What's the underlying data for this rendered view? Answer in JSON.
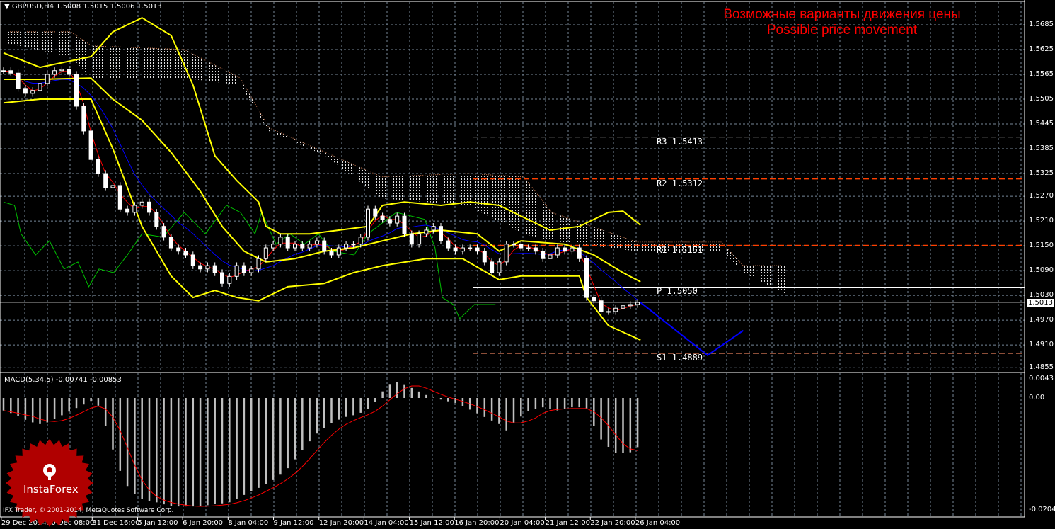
{
  "header": {
    "symbol_tf": "GBPUSD,H4",
    "ohlc": "1.5008 1.5015 1.5006 1.5013"
  },
  "annotation": {
    "ru": "Возможные варианты движения цены",
    "en": "Possible price movement"
  },
  "macd_header": "MACD(5,34,5) -0.00741 -0.00853",
  "copyright": "IFX Trader, © 2001-2014, MetaQuotes Software Corp.",
  "logo_text": "InstaForex",
  "current_price": "1.5013",
  "colors": {
    "bollinger": "#ffff00",
    "tenkan": "#ff0000",
    "kijun": "#0000ff",
    "chikou": "#00c000",
    "forecast": "#0000ff",
    "pivot_orange": "#ff4000",
    "macd_hist": "#c0c0c0",
    "macd_signal": "#ff0000",
    "grid": "#778899"
  },
  "chart_data": [
    {
      "type": "candlestick",
      "title": "GBPUSD,H4",
      "price_axis": {
        "ylim": [
          1.483,
          1.5745
        ],
        "ticks": [
          "1.5685",
          "1.5625",
          "1.5565",
          "1.5505",
          "1.5445",
          "1.5385",
          "1.5325",
          "1.5270",
          "1.5210",
          "1.5150",
          "1.5090",
          "1.5030",
          "1.4970",
          "1.4910",
          "1.4855"
        ]
      },
      "time_axis": {
        "ticks": [
          "29 Dec 2014",
          "30 Dec 08:00",
          "31 Dec 16:00",
          "5 Jan 12:00",
          "6 Jan 20:00",
          "8 Jan 04:00",
          "9 Jan 12:00",
          "12 Jan 20:00",
          "14 Jan 04:00",
          "15 Jan 12:00",
          "16 Jan 20:00",
          "20 Jan 04:00",
          "21 Jan 12:00",
          "22 Jan 20:00",
          "26 Jan 04:00"
        ]
      },
      "closes": [
        1.5574,
        1.5568,
        1.5531,
        1.5519,
        1.5526,
        1.5543,
        1.5565,
        1.5574,
        1.5577,
        1.5565,
        1.5488,
        1.5428,
        1.5359,
        1.5325,
        1.5291,
        1.5296,
        1.5239,
        1.5231,
        1.5248,
        1.5256,
        1.5231,
        1.5197,
        1.5171,
        1.5145,
        1.5137,
        1.5128,
        1.5102,
        1.5094,
        1.5102,
        1.5085,
        1.5059,
        1.5076,
        1.5102,
        1.5085,
        1.5094,
        1.5119,
        1.5145,
        1.5154,
        1.5171,
        1.5145,
        1.5154,
        1.5145,
        1.5154,
        1.5162,
        1.5137,
        1.5128,
        1.5145,
        1.5154,
        1.5154,
        1.5171,
        1.5239,
        1.5222,
        1.5214,
        1.5205,
        1.5222,
        1.5179,
        1.5154,
        1.5179,
        1.5188,
        1.5197,
        1.5162,
        1.5145,
        1.5137,
        1.5145,
        1.5145,
        1.5137,
        1.5111,
        1.5085,
        1.5111,
        1.5154,
        1.5154,
        1.5145,
        1.5145,
        1.5137,
        1.5119,
        1.5128,
        1.5145,
        1.5137,
        1.5145,
        1.5119,
        1.5025,
        1.5017,
        1.4991,
        1.4991,
        1.4999,
        1.5005,
        1.5008,
        1.5013
      ],
      "bollinger_upper": [
        [
          0,
          1.5617
        ],
        [
          5,
          1.5582
        ],
        [
          12,
          1.5608
        ],
        [
          15,
          1.5668
        ],
        [
          19,
          1.5702
        ],
        [
          23,
          1.5659
        ],
        [
          26,
          1.5539
        ],
        [
          29,
          1.5368
        ],
        [
          32,
          1.5308
        ],
        [
          35,
          1.5256
        ],
        [
          36,
          1.5197
        ],
        [
          38,
          1.5179
        ],
        [
          42,
          1.5179
        ],
        [
          46,
          1.5188
        ],
        [
          50,
          1.5197
        ],
        [
          52,
          1.5248
        ],
        [
          55,
          1.5256
        ],
        [
          60,
          1.5248
        ],
        [
          64,
          1.5256
        ],
        [
          68,
          1.5248
        ],
        [
          71,
          1.5222
        ],
        [
          75,
          1.5188
        ],
        [
          79,
          1.5197
        ],
        [
          83,
          1.5231
        ],
        [
          85,
          1.5234
        ],
        [
          87.4,
          1.52
        ]
      ],
      "bollinger_middle": [
        [
          0,
          1.5553
        ],
        [
          5,
          1.5553
        ],
        [
          12,
          1.5556
        ],
        [
          15,
          1.5505
        ],
        [
          19,
          1.5454
        ],
        [
          23,
          1.5376
        ],
        [
          27,
          1.5282
        ],
        [
          30,
          1.5197
        ],
        [
          33,
          1.5137
        ],
        [
          36,
          1.5111
        ],
        [
          40,
          1.5119
        ],
        [
          44,
          1.5137
        ],
        [
          48,
          1.5145
        ],
        [
          52,
          1.5162
        ],
        [
          56,
          1.5179
        ],
        [
          60,
          1.5188
        ],
        [
          65,
          1.5179
        ],
        [
          68,
          1.5137
        ],
        [
          71,
          1.5162
        ],
        [
          77,
          1.5154
        ],
        [
          81,
          1.5128
        ],
        [
          85,
          1.5085
        ],
        [
          87.4,
          1.5063
        ]
      ],
      "bollinger_lower": [
        [
          0,
          1.5496
        ],
        [
          5,
          1.5505
        ],
        [
          12,
          1.5505
        ],
        [
          15,
          1.5385
        ],
        [
          19,
          1.5197
        ],
        [
          23,
          1.5077
        ],
        [
          26,
          1.5025
        ],
        [
          29,
          1.5042
        ],
        [
          32,
          1.5025
        ],
        [
          35,
          1.5017
        ],
        [
          39,
          1.5051
        ],
        [
          44,
          1.5059
        ],
        [
          48,
          1.5085
        ],
        [
          52,
          1.5102
        ],
        [
          58,
          1.5119
        ],
        [
          63,
          1.5119
        ],
        [
          68,
          1.5068
        ],
        [
          71,
          1.5077
        ],
        [
          79,
          1.5077
        ],
        [
          80,
          1.5025
        ],
        [
          83,
          1.4957
        ],
        [
          87.4,
          1.4922
        ]
      ],
      "chikou": [
        [
          0,
          1.5256
        ],
        [
          1.5,
          1.5248
        ],
        [
          2.4,
          1.5179
        ],
        [
          4.4,
          1.5128
        ],
        [
          6.3,
          1.5162
        ],
        [
          8.3,
          1.5094
        ],
        [
          10.2,
          1.5111
        ],
        [
          11.7,
          1.5051
        ],
        [
          13.1,
          1.5094
        ],
        [
          15.1,
          1.5085
        ],
        [
          17,
          1.5128
        ],
        [
          19,
          1.5179
        ],
        [
          21.9,
          1.5171
        ],
        [
          24.8,
          1.5231
        ],
        [
          27.7,
          1.5179
        ],
        [
          30.6,
          1.5248
        ],
        [
          32.5,
          1.5231
        ],
        [
          34.5,
          1.5179
        ],
        [
          35.4,
          1.5231
        ],
        [
          37.4,
          1.5154
        ],
        [
          39.3,
          1.5179
        ],
        [
          41.3,
          1.5154
        ],
        [
          43.2,
          1.5179
        ],
        [
          45.1,
          1.5137
        ],
        [
          48.1,
          1.5128
        ],
        [
          50,
          1.5179
        ],
        [
          53.9,
          1.5231
        ],
        [
          57.8,
          1.5214
        ],
        [
          59.2,
          1.5145
        ],
        [
          60.2,
          1.5025
        ],
        [
          61.7,
          1.5008
        ],
        [
          62.6,
          1.4974
        ],
        [
          64.6,
          1.5008
        ],
        [
          67.5,
          1.5008
        ]
      ],
      "cloud": [
        [
          0,
          1.5668,
          1.5642
        ],
        [
          9.2,
          1.5668,
          1.5608
        ],
        [
          12.1,
          1.5634,
          1.5556
        ],
        [
          24.8,
          1.5625,
          1.5556
        ],
        [
          32.5,
          1.5556,
          1.5539
        ],
        [
          36.4,
          1.5436,
          1.5428
        ],
        [
          44.2,
          1.5376,
          1.5368
        ],
        [
          51.9,
          1.5317,
          1.5265
        ],
        [
          63.6,
          1.5325,
          1.5248
        ],
        [
          71.4,
          1.5317,
          1.5179
        ],
        [
          75.2,
          1.5231,
          1.5162
        ],
        [
          86.9,
          1.5159,
          1.5137
        ],
        [
          98.5,
          1.5159,
          1.5137
        ],
        [
          101.5,
          1.5102,
          1.5085
        ],
        [
          107.3,
          1.5102,
          1.5034
        ]
      ],
      "forecast": [
        [
          87.4,
          1.5013
        ],
        [
          96.6,
          1.4885
        ],
        [
          101.5,
          1.4945
        ]
      ],
      "pivots": [
        {
          "name": "R3",
          "value": "1.5413",
          "label": "R3  1.5413",
          "style": "grey"
        },
        {
          "name": "R2",
          "value": "1.5312",
          "label": "R2  1.5312",
          "style": "orange"
        },
        {
          "name": "R1",
          "value": "1.5151",
          "label": "R1  1.5151",
          "style": "orange"
        },
        {
          "name": "P",
          "value": "1.5050",
          "label": "P  1.5050",
          "style": "white"
        },
        {
          "name": "S1",
          "value": "1.4889",
          "label": "S1  1.4889",
          "style": "brown"
        }
      ]
    },
    {
      "type": "bar",
      "title": "MACD(5,34,5)",
      "values_label": [
        "-0.00741",
        "-0.00853"
      ],
      "axis": {
        "ticks": [
          "0.0043",
          "0.00",
          "-0.02046"
        ]
      },
      "histogram": [
        [
          0,
          -0.0023
        ],
        [
          1.5,
          -0.003
        ],
        [
          3.4,
          -0.0043
        ],
        [
          5.3,
          -0.0049
        ],
        [
          7.3,
          -0.0036
        ],
        [
          9.2,
          -0.0023
        ],
        [
          11.2,
          -0.001
        ],
        [
          12.1,
          -0.0004
        ],
        [
          13.1,
          -0.0017
        ],
        [
          14.1,
          -0.0062
        ],
        [
          15,
          -0.0101
        ],
        [
          16,
          -0.014
        ],
        [
          17,
          -0.0166
        ],
        [
          18,
          -0.0179
        ],
        [
          19,
          -0.0186
        ],
        [
          20.9,
          -0.0192
        ],
        [
          22.8,
          -0.0199
        ],
        [
          24.8,
          -0.0199
        ],
        [
          26.7,
          -0.0199
        ],
        [
          28.6,
          -0.0195
        ],
        [
          30.6,
          -0.0192
        ],
        [
          32.5,
          -0.0179
        ],
        [
          34.5,
          -0.0166
        ],
        [
          36.4,
          -0.0153
        ],
        [
          38.3,
          -0.0134
        ],
        [
          40.3,
          -0.0101
        ],
        [
          42.2,
          -0.0069
        ],
        [
          44.2,
          -0.0049
        ],
        [
          46.1,
          -0.0036
        ],
        [
          48.1,
          -0.003
        ],
        [
          50,
          -0.0017
        ],
        [
          51,
          0.0003
        ],
        [
          52,
          0.0022
        ],
        [
          52.9,
          0.0029
        ],
        [
          53.9,
          0.0029
        ],
        [
          54.9,
          0.0022
        ],
        [
          55.8,
          0.0016
        ],
        [
          57.8,
          0.0003
        ],
        [
          59.7,
          -0.0004
        ],
        [
          61.7,
          -0.001
        ],
        [
          63.6,
          -0.0023
        ],
        [
          65.5,
          -0.0036
        ],
        [
          67.5,
          -0.0049
        ],
        [
          68.5,
          -0.0062
        ],
        [
          69.4,
          -0.0043
        ],
        [
          71.4,
          -0.0023
        ],
        [
          73.3,
          -0.0017
        ],
        [
          75.2,
          -0.0023
        ],
        [
          77.2,
          -0.0017
        ],
        [
          79.1,
          -0.0017
        ],
        [
          80.1,
          -0.0049
        ],
        [
          81.1,
          -0.0075
        ],
        [
          83,
          -0.0101
        ],
        [
          85,
          -0.0101
        ],
        [
          87,
          -0.0082
        ]
      ]
    }
  ]
}
